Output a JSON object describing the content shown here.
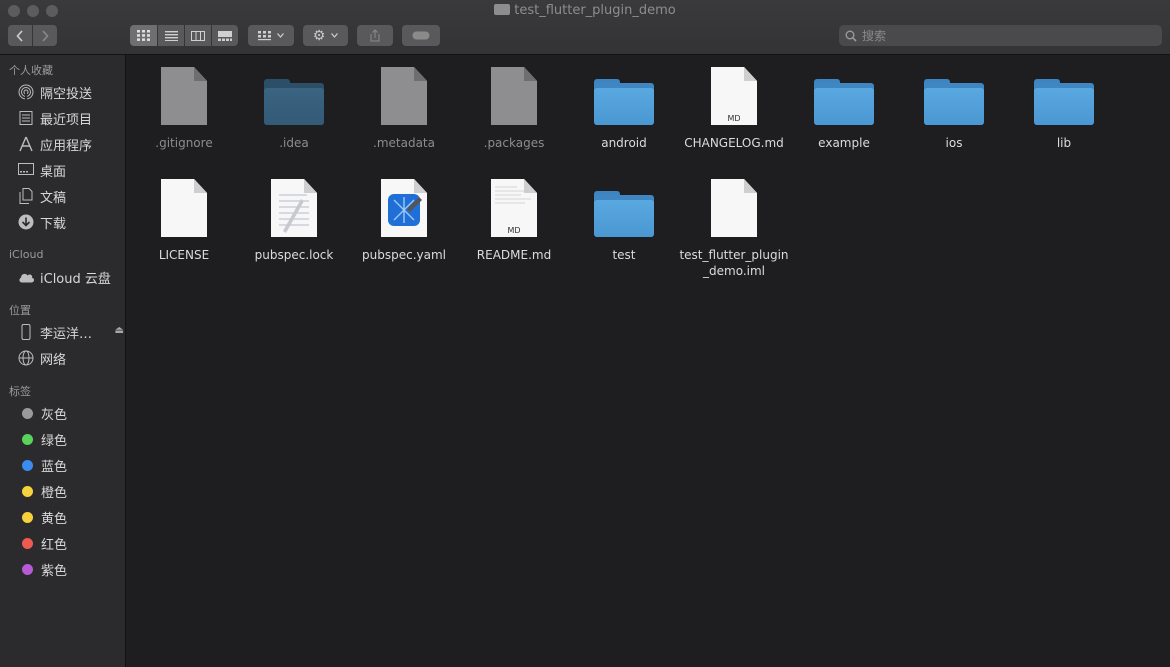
{
  "window": {
    "title": "test_flutter_plugin_demo"
  },
  "search": {
    "placeholder": "搜索"
  },
  "sidebar": {
    "favorites_header": "个人收藏",
    "favorites": [
      {
        "label": "隔空投送",
        "icon": "airdrop-icon"
      },
      {
        "label": "最近项目",
        "icon": "recents-icon"
      },
      {
        "label": "应用程序",
        "icon": "applications-icon"
      },
      {
        "label": "桌面",
        "icon": "desktop-icon"
      },
      {
        "label": "文稿",
        "icon": "documents-icon"
      },
      {
        "label": "下载",
        "icon": "downloads-icon"
      }
    ],
    "icloud_header": "iCloud",
    "icloud": [
      {
        "label": "iCloud 云盘",
        "icon": "cloud-icon"
      }
    ],
    "locations_header": "位置",
    "locations": [
      {
        "label": "李运洋…",
        "icon": "iphone-icon"
      },
      {
        "label": "网络",
        "icon": "network-icon"
      }
    ],
    "tags_header": "标签",
    "tags": [
      {
        "label": "灰色",
        "color": "#9a9a9c"
      },
      {
        "label": "绿色",
        "color": "#5ad35c"
      },
      {
        "label": "蓝色",
        "color": "#3b8cf0"
      },
      {
        "label": "橙色",
        "color": "#f6d23f"
      },
      {
        "label": "黄色",
        "color": "#f7d03c"
      },
      {
        "label": "红色",
        "color": "#ee5a52"
      },
      {
        "label": "紫色",
        "color": "#b65ad6"
      }
    ]
  },
  "files": [
    {
      "name": ".gitignore",
      "kind": "doc-grey",
      "hidden": true
    },
    {
      "name": ".idea",
      "kind": "folder-dim",
      "hidden": true
    },
    {
      "name": ".metadata",
      "kind": "doc-grey",
      "hidden": true
    },
    {
      "name": ".packages",
      "kind": "doc-grey",
      "hidden": true
    },
    {
      "name": "android",
      "kind": "folder",
      "hidden": false
    },
    {
      "name": "CHANGELOG.md",
      "kind": "doc-md",
      "hidden": false,
      "badge": "MD"
    },
    {
      "name": "example",
      "kind": "folder",
      "hidden": false
    },
    {
      "name": "ios",
      "kind": "folder",
      "hidden": false
    },
    {
      "name": "lib",
      "kind": "folder",
      "hidden": false
    },
    {
      "name": "LICENSE",
      "kind": "doc",
      "hidden": false
    },
    {
      "name": "pubspec.lock",
      "kind": "lock",
      "hidden": false
    },
    {
      "name": "pubspec.yaml",
      "kind": "xcode",
      "hidden": false
    },
    {
      "name": "README.md",
      "kind": "doc-md",
      "hidden": false,
      "badge": "MD"
    },
    {
      "name": "test",
      "kind": "folder",
      "hidden": false
    },
    {
      "name": "test_flutter_plugin_demo.iml",
      "kind": "doc",
      "hidden": false,
      "line1": "test_flutter_plugin",
      "line2": "_demo.iml"
    }
  ]
}
